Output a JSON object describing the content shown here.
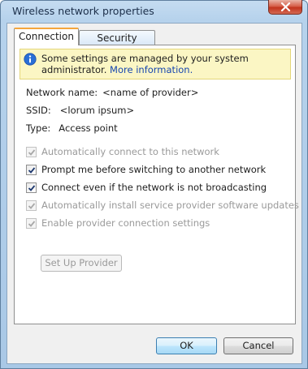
{
  "window": {
    "title": "Wireless network properties"
  },
  "tabs": [
    {
      "label": "Connection",
      "selected": true
    },
    {
      "label": "Security",
      "selected": false
    }
  ],
  "infobar": {
    "text": "Some settings are managed by your system administrator.",
    "link": "More information.",
    "icon": "info-icon",
    "background": "#fbf6c4"
  },
  "properties": {
    "network_name_label": "Network name:",
    "network_name_value": "<name of provider>",
    "ssid_label": "SSID:",
    "ssid_value": "<lorum ipsum>",
    "type_label": "Type:",
    "type_value": "Access point"
  },
  "options": [
    {
      "label": "Automatically connect to this network",
      "checked": true,
      "enabled": false
    },
    {
      "label": "Prompt me before switching to another network",
      "checked": true,
      "enabled": true
    },
    {
      "label": "Connect even if the network is not broadcasting",
      "checked": true,
      "enabled": true
    },
    {
      "label": "Automatically install service provider software updates",
      "checked": true,
      "enabled": false
    },
    {
      "label": "Enable provider connection settings",
      "checked": true,
      "enabled": false
    }
  ],
  "buttons": {
    "setup": "Set Up Provider",
    "ok": "OK",
    "cancel": "Cancel"
  },
  "colors": {
    "accent_tab": "#f5a63d",
    "link": "#1747b0",
    "info_icon": "#2a6fd6"
  }
}
